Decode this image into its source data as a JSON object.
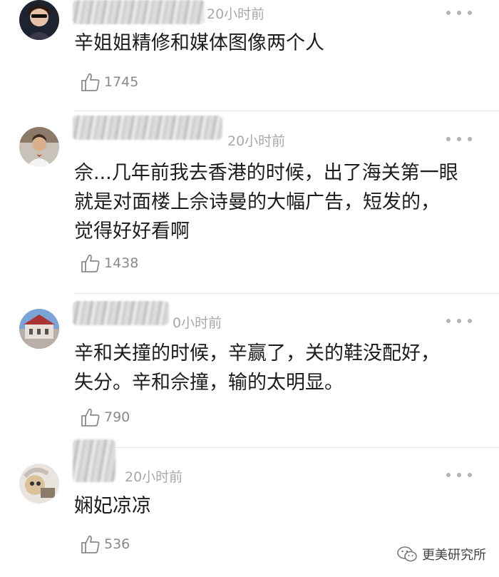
{
  "comments": [
    {
      "time": "20小时前",
      "lines": [
        "辛姐姐精修和媒体图像两个人"
      ],
      "likes": "1745"
    },
    {
      "time": "20小时前",
      "lines": [
        "佘...几年前我去香港的时候，出了海关第一眼",
        "就是对面楼上佘诗曼的大幅广告，短发的，",
        "觉得好好看啊"
      ],
      "likes": "1438"
    },
    {
      "time": "0小时前",
      "lines": [
        "辛和关撞的时候，辛赢了，关的鞋没配好，",
        "失分。辛和佘撞，输的太明显。"
      ],
      "likes": "790"
    },
    {
      "time": "20小时前",
      "lines": [
        "娴妃凉凉"
      ],
      "likes": "536"
    }
  ],
  "icons": {
    "like": "thumbs-up-icon",
    "more": "more-dots-icon",
    "watermark": "wechat-icon"
  },
  "watermark": {
    "label": "更美研究所"
  },
  "colors": {
    "text": "#1c1c1c",
    "meta": "#a8a8a8",
    "divider": "#e6e6e6"
  }
}
